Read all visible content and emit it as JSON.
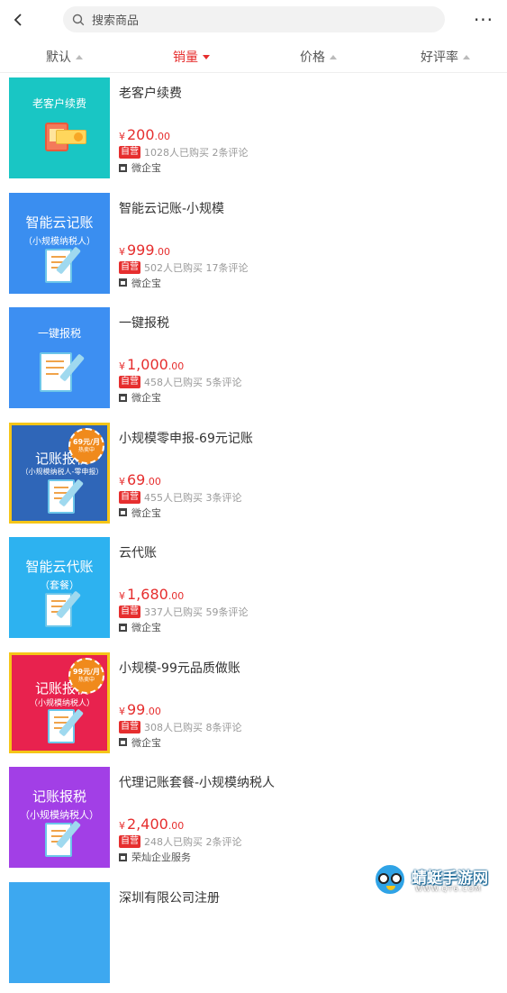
{
  "header": {
    "search_placeholder": "搜索商品",
    "more_label": "···"
  },
  "sort": {
    "items": [
      {
        "label": "默认",
        "active": false
      },
      {
        "label": "销量",
        "active": true
      },
      {
        "label": "价格",
        "active": false
      },
      {
        "label": "好评率",
        "active": false
      }
    ]
  },
  "products": [
    {
      "name": "老客户续费",
      "thumb_title": "老客户续费",
      "thumb_sub": "",
      "bg": "#19c6c4",
      "price_int": "200",
      "price_dec": ".00",
      "badge": "自营",
      "stats": "1028人已购买 2条评论",
      "shop": "微企宝"
    },
    {
      "name": "智能云记账-小规模",
      "thumb_title": "智能云记账",
      "thumb_sub": "（小规模纳税人）",
      "bg": "#3a8ef0",
      "price_int": "999",
      "price_dec": ".00",
      "badge": "自营",
      "stats": "502人已购买 17条评论",
      "shop": "微企宝"
    },
    {
      "name": "一键报税",
      "thumb_title": "一键报税",
      "thumb_sub": "",
      "bg": "#3d8ff2",
      "price_int": "1,000",
      "price_dec": ".00",
      "badge": "自营",
      "stats": "458人已购买 5条评论",
      "shop": "微企宝"
    },
    {
      "name": "小规模零申报-69元记账",
      "thumb_title": "记账报税",
      "thumb_sub": "（小规模纳税人-零申报）",
      "bg": "#2f66b8",
      "stamp1": "69元/月",
      "stamp2": "热卖中",
      "price_int": "69",
      "price_dec": ".00",
      "badge": "自营",
      "stats": "455人已购买 3条评论",
      "shop": "微企宝"
    },
    {
      "name": "云代账",
      "thumb_title": "智能云代账",
      "thumb_sub": "（套餐）",
      "bg": "#2db2f0",
      "price_int": "1,680",
      "price_dec": ".00",
      "badge": "自营",
      "stats": "337人已购买 59条评论",
      "shop": "微企宝"
    },
    {
      "name": "小规模-99元品质做账",
      "thumb_title": "记账报税",
      "thumb_sub": "（小规模纳税人）",
      "bg": "#e8224e",
      "stamp1": "99元/月",
      "stamp2": "热卖中",
      "price_int": "99",
      "price_dec": ".00",
      "badge": "自营",
      "stats": "308人已购买 8条评论",
      "shop": "微企宝"
    },
    {
      "name": "代理记账套餐-小规模纳税人",
      "thumb_title": "记账报税",
      "thumb_sub": "（小规模纳税人）",
      "bg": "#a23fe6",
      "price_int": "2,400",
      "price_dec": ".00",
      "badge": "自营",
      "stats": "248人已购买 2条评论",
      "shop": "荣灿企业服务"
    },
    {
      "name": "深圳有限公司注册",
      "thumb_title": "",
      "thumb_sub": "",
      "bg": "#3da8f0"
    }
  ],
  "currency": "¥",
  "watermark": {
    "title": "蜻蜓手游网",
    "url": "WWW.QT6.COM"
  }
}
